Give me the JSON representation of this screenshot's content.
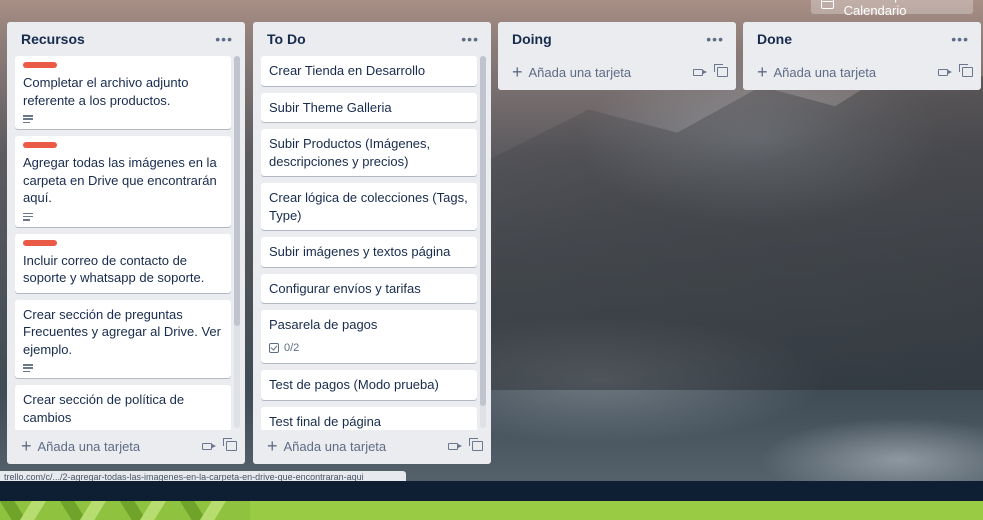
{
  "header": {
    "powerup_label": "Power-Up Calendario",
    "powerup_icon": "calendar-icon"
  },
  "lists": [
    {
      "title": "Recursos",
      "cards": [
        {
          "text": "Completar el archivo adjunto referente a los productos.",
          "label": "red",
          "description": true
        },
        {
          "text": "Agregar todas las imágenes en la carpeta en Drive que encontrarán aquí.",
          "label": "red",
          "description": true
        },
        {
          "text": "Incluir correo de contacto de soporte y whatsapp de soporte.",
          "label": "red",
          "description": false
        },
        {
          "text": "Crear sección de preguntas Frecuentes y agregar al Drive. Ver ejemplo.",
          "description": true
        },
        {
          "text": "Crear sección de política de cambios"
        }
      ],
      "add_label": "Añada una tarjeta"
    },
    {
      "title": "To Do",
      "cards": [
        {
          "text": "Crear Tienda en Desarrollo"
        },
        {
          "text": "Subir Theme Galleria"
        },
        {
          "text": "Subir Productos (Imágenes, descripciones y precios)"
        },
        {
          "text": "Crear lógica de colecciones (Tags, Type)"
        },
        {
          "text": "Subir imágenes y textos página"
        },
        {
          "text": "Configurar envíos y tarifas"
        },
        {
          "text": "Pasarela de pagos",
          "checklist": "0/2"
        },
        {
          "text": "Test de pagos (Modo prueba)"
        },
        {
          "text": "Test final de página",
          "description": true
        }
      ],
      "add_label": "Añada una tarjeta"
    },
    {
      "title": "Doing",
      "cards": [],
      "add_label": "Añada una tarjeta"
    },
    {
      "title": "Done",
      "cards": [],
      "add_label": "Añada una tarjeta"
    }
  ],
  "status_url": "trello.com/c/.../2-agregar-todas-las-imagenes-en-la-carpeta-en-drive-que-encontraran-aqui",
  "colors": {
    "label_red": "#eb5a46",
    "list_bg": "#ebecf0",
    "footer_dark": "#0e1f33",
    "footer_green": "#8ec23f"
  }
}
